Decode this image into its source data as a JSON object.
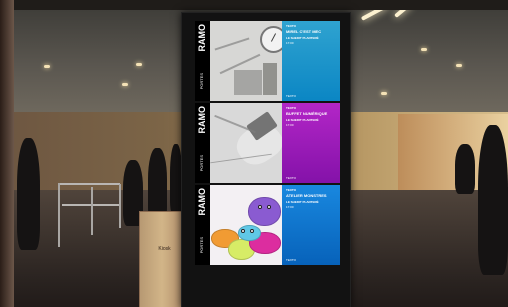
{
  "screen": {
    "panels": [
      {
        "brand": "RAMO",
        "brand_sub": "PORTES",
        "label": "TEXTO",
        "title": "MIREL C'EST MEC",
        "location": "LE SHEDIT PLANTERÉ",
        "time": "17:00",
        "mark": "TEXTO",
        "color": "#0b86c4"
      },
      {
        "brand": "RAMO",
        "brand_sub": "PORTES",
        "label": "TEXTO",
        "title": "BUFFET NUMÉRIQUE",
        "location": "LE SHEDIT PLANTERÉ",
        "time": "17:00",
        "mark": "TEXTO",
        "color": "#8412a9"
      },
      {
        "brand": "RAMO",
        "brand_sub": "PORTES",
        "label": "TEXTO",
        "title": "ATELIER MONSTRES",
        "location": "LE SHEDIT PLANTERÉ",
        "time": "17:00",
        "mark": "TEXTO",
        "color": "#0762ba"
      }
    ]
  },
  "counter": {
    "label": "Kiosk"
  },
  "colors": {
    "panel_one": "#0b86c4",
    "panel_two": "#8412a9",
    "panel_three": "#0762ba",
    "warm_light": "#f4e2b6"
  }
}
